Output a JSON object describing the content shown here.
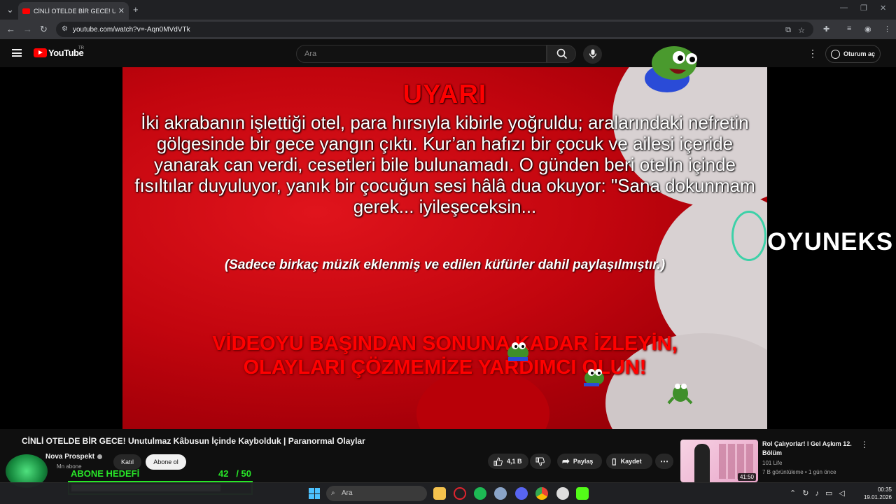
{
  "browser": {
    "tab_title": "CİNLİ OTELDE BİR GECE! Unutul",
    "url": "youtube.com/watch?v=-Aqn0MVdVTk"
  },
  "youtube": {
    "logo_text": "YouTube",
    "region": "TR",
    "search_placeholder": "Ara",
    "signin_label": "Oturum aç"
  },
  "video": {
    "heading": "UYARI",
    "body": "İki akrabanın işlettiği otel, para hırsıyla kibirle yoğruldu; aralarındaki nefretin gölgesinde bir gece yangın çıktı. Kur’an hafızı bir çocuk ve ailesi içeride yanarak can verdi, cesetleri bile bulunamadı. O günden beri otelin içinde fısıltılar duyuluyor, yanık bir çocuğun sesi hâlâ dua okuyor: \"Sana dokunmam gerek... iyileşeceksin...",
    "note": "(Sadece birkaç müzik eklenmiş ve edilen küfürler dahil paylaşılmıştır.)",
    "cta_line1": "VİDEOYU BAŞINDAN SONUNA KADAR İZLEYİN,",
    "cta_line2": "OLAYLARI ÇÖZMEMİZE YARDIMCI OLUN!",
    "watermark": "OYUNEKS"
  },
  "details": {
    "title": "CİNLİ OTELDE BİR GECE! Unutulmaz Kâbusun İçinde Kaybolduk | Paranormal Olaylar",
    "channel": "Nova Prospekt",
    "subscribers": "Mn abone",
    "join_label": "Katıl",
    "subscribe_label": "Abone ol",
    "likes": "4,1 B",
    "share_label": "Paylaş",
    "save_label": "Kaydet"
  },
  "overlay_goal": {
    "label": "ABONE HEDEFİ",
    "current": "42",
    "target": "/ 50",
    "progress": 0.84
  },
  "recommendation": {
    "title": "Rol Çalıyorlar! l Gel Aşkım 12. Bölüm",
    "channel": "101 Life",
    "meta": "7 B görüntüleme • 1 gün önce",
    "duration": "41:50"
  },
  "taskbar": {
    "search_placeholder": "Ara",
    "time": "00:35",
    "date": "19.01.2026"
  },
  "colors": {
    "youtube_red": "#ff0000",
    "goal_green": "#28e628",
    "video_red": "#c2050e"
  }
}
